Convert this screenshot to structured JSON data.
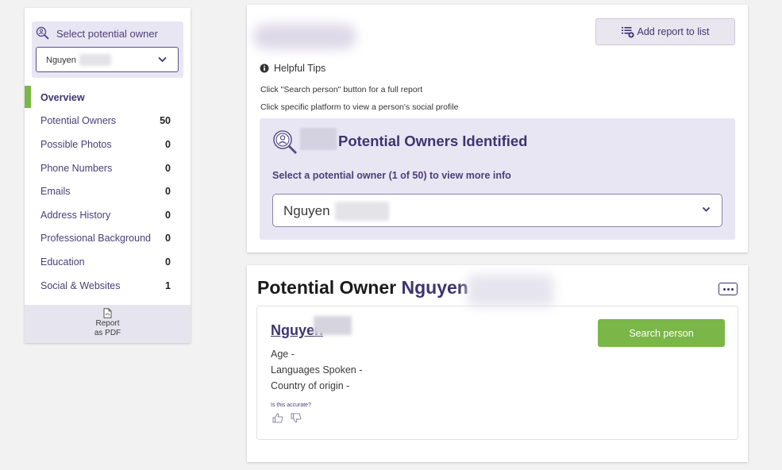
{
  "sidebar": {
    "select_label": "Select potential owner",
    "selected_owner": "Nguyen",
    "items": [
      {
        "label": "Overview",
        "count": ""
      },
      {
        "label": "Potential Owners",
        "count": "50"
      },
      {
        "label": "Possible Photos",
        "count": "0"
      },
      {
        "label": "Phone Numbers",
        "count": "0"
      },
      {
        "label": "Emails",
        "count": "0"
      },
      {
        "label": "Address History",
        "count": "0"
      },
      {
        "label": "Professional Background",
        "count": "0"
      },
      {
        "label": "Education",
        "count": "0"
      },
      {
        "label": "Social & Websites",
        "count": "1"
      }
    ],
    "pdf_line1": "Report",
    "pdf_line2": "as PDF"
  },
  "top_card": {
    "add_report_label": "Add report to list",
    "tips_title": "Helpful Tips",
    "tip1": "Click \"Search person\" button for a full report",
    "tip2": "Click specific platform to view a person's social profile",
    "panel_title": "Potential Owners Identified",
    "panel_subtitle": "Select a potential owner (1 of 50) to view more info",
    "selected_owner": "Nguyen"
  },
  "owner_card": {
    "heading_prefix": "Potential Owner",
    "heading_name": "Nguyen",
    "person_name": "Nguyen",
    "search_button": "Search person",
    "age_label": "Age -",
    "languages_label": "Languages Spoken -",
    "country_label": "Country of origin -",
    "accurate_question": "Is this accurate?"
  },
  "colors": {
    "accent_purple": "#3e3470",
    "accent_green": "#7ab648",
    "panel_bg": "#e9e6f4"
  }
}
